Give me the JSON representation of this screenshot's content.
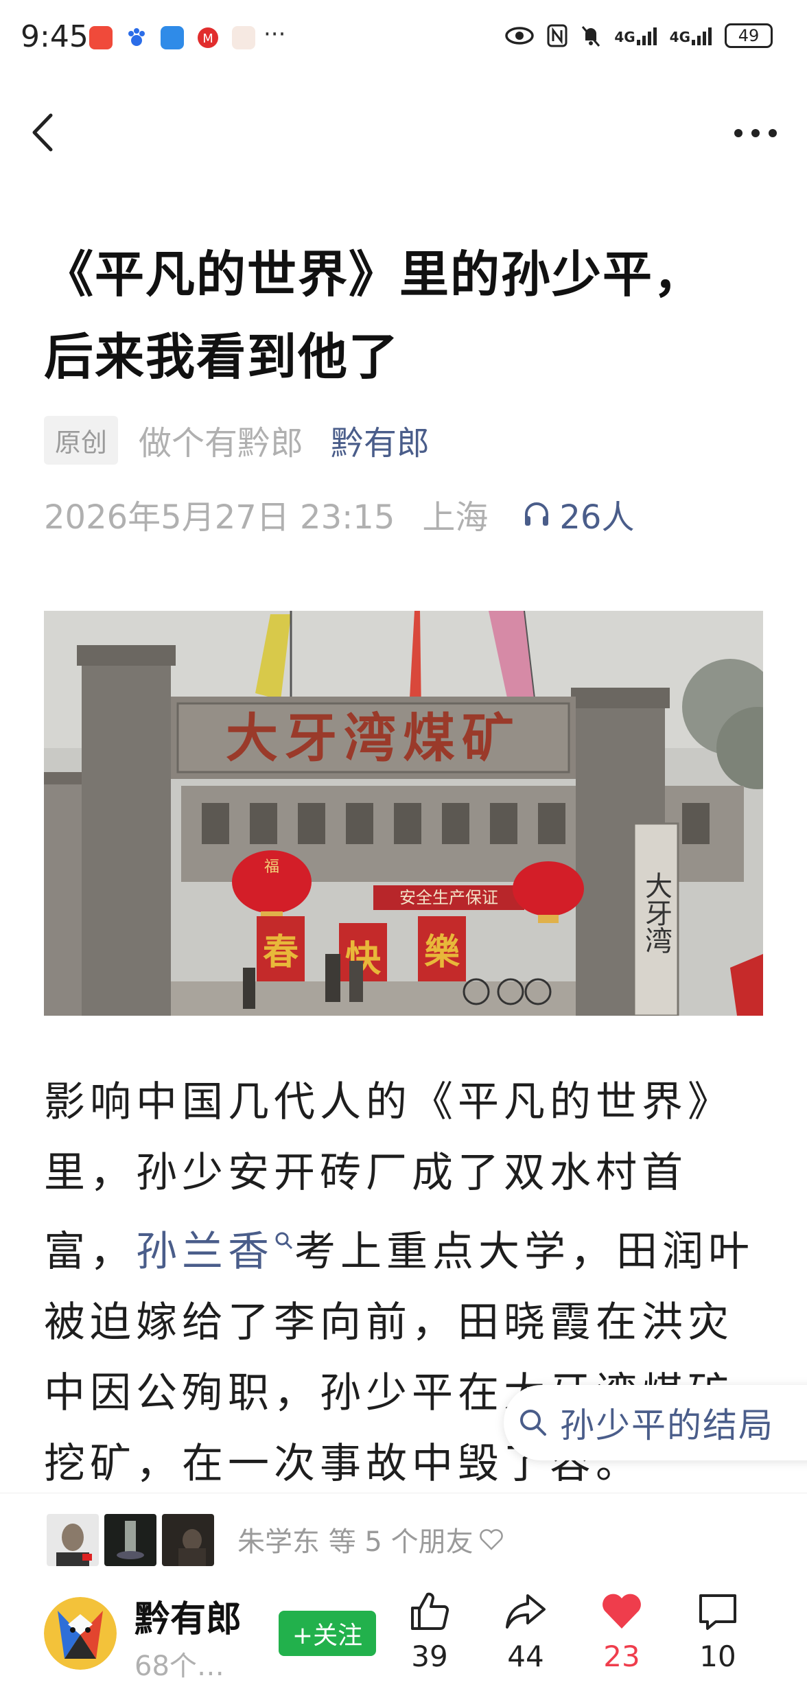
{
  "status_bar": {
    "time": "9:45",
    "battery": "49",
    "signal1": "4G",
    "signal2": "4G",
    "overflow": "···"
  },
  "nav": {
    "back_icon": "chevron-left-icon",
    "more_icon": "more-horizontal-icon"
  },
  "article": {
    "title_line1": "《平凡的世界》里的孙少平，",
    "title_line2": "后来我看到他了",
    "badge": "原创",
    "source": "做个有黔郎",
    "author": "黔有郎",
    "datetime": "2026年5月27日 23:15",
    "location": "上海",
    "listeners": "26人",
    "hero_sign": "大牙湾煤矿",
    "hero_banner": "安全生产保证",
    "hero_couplet": [
      "春",
      "快",
      "樂"
    ],
    "hero_lantern": "福",
    "hero_side_sign": "大牙湾",
    "body_p1": "影响中国几代人的《平凡的世界》里，孙少安开砖厂成了双水村首富，",
    "body_keyword": "孙兰香",
    "body_p2": "考上重点大学，田润叶被迫嫁给了李向前，田晓霞在洪灾中因公殉职，孙少平在大牙湾煤矿挖矿，在一次事故中毁了容。"
  },
  "search_suggest": {
    "label": "孙少平的结局"
  },
  "friends": {
    "text": "朱学东 等 5 个朋友"
  },
  "bottom": {
    "author_name": "黔有郎",
    "author_sub": "68个…",
    "follow_label": "+关注",
    "like_count": "39",
    "share_count": "44",
    "heart_count": "23",
    "comment_count": "10"
  },
  "colors": {
    "link": "#4a5d8a",
    "follow_green": "#22b14c",
    "heart_red": "#ef3d4c"
  }
}
